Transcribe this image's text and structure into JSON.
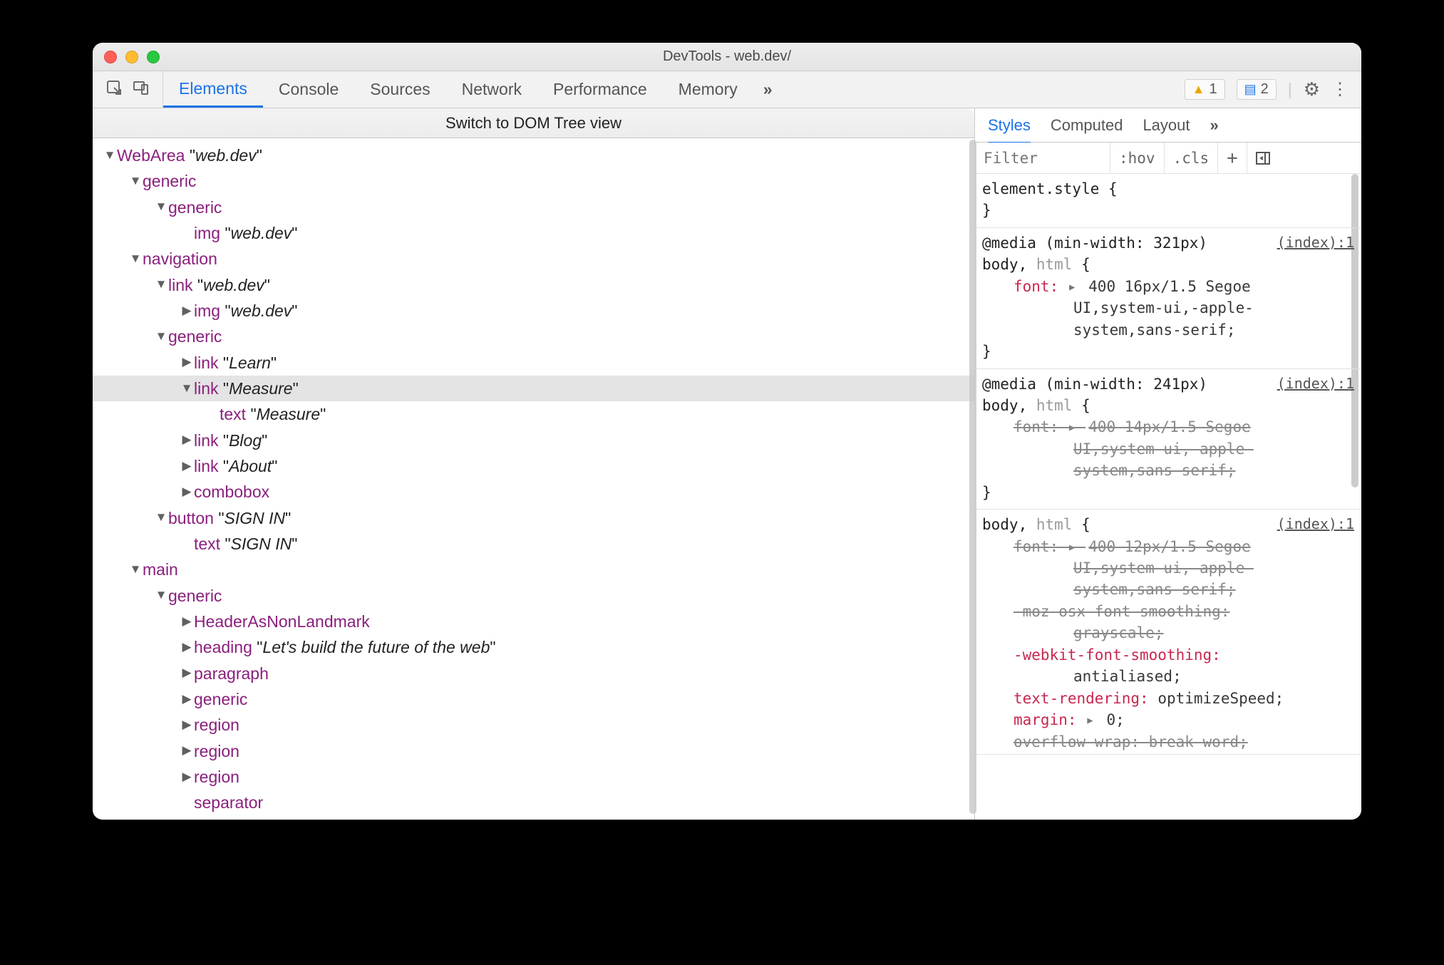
{
  "window": {
    "title": "DevTools - web.dev/"
  },
  "toolbar": {
    "tabs": [
      "Elements",
      "Console",
      "Sources",
      "Network",
      "Performance",
      "Memory"
    ],
    "more": "»",
    "warnings_count": "1",
    "issues_count": "2"
  },
  "switch_bar": "Switch to DOM Tree view",
  "tree": [
    {
      "ind": 0,
      "arrow": "down",
      "role": "WebArea",
      "name": "web.dev"
    },
    {
      "ind": 1,
      "arrow": "down",
      "role": "generic"
    },
    {
      "ind": 2,
      "arrow": "down",
      "role": "generic"
    },
    {
      "ind": 3,
      "arrow": "none",
      "role": "img",
      "name": "web.dev"
    },
    {
      "ind": 1,
      "arrow": "down",
      "role": "navigation"
    },
    {
      "ind": 2,
      "arrow": "down",
      "role": "link",
      "name": "web.dev"
    },
    {
      "ind": 3,
      "arrow": "right",
      "role": "img",
      "name": "web.dev"
    },
    {
      "ind": 2,
      "arrow": "down",
      "role": "generic"
    },
    {
      "ind": 3,
      "arrow": "right",
      "role": "link",
      "name": "Learn"
    },
    {
      "ind": 3,
      "arrow": "down",
      "role": "link",
      "name": "Measure",
      "selected": true
    },
    {
      "ind": 4,
      "arrow": "none",
      "role": "text",
      "name": "Measure"
    },
    {
      "ind": 3,
      "arrow": "right",
      "role": "link",
      "name": "Blog"
    },
    {
      "ind": 3,
      "arrow": "right",
      "role": "link",
      "name": "About"
    },
    {
      "ind": 3,
      "arrow": "right",
      "role": "combobox"
    },
    {
      "ind": 2,
      "arrow": "down",
      "role": "button",
      "name": "SIGN IN"
    },
    {
      "ind": 3,
      "arrow": "none",
      "role": "text",
      "name": "SIGN IN"
    },
    {
      "ind": 1,
      "arrow": "down",
      "role": "main"
    },
    {
      "ind": 2,
      "arrow": "down",
      "role": "generic"
    },
    {
      "ind": 3,
      "arrow": "right",
      "role": "HeaderAsNonLandmark"
    },
    {
      "ind": 3,
      "arrow": "right",
      "role": "heading",
      "name": "Let's build the future of the web"
    },
    {
      "ind": 3,
      "arrow": "right",
      "role": "paragraph"
    },
    {
      "ind": 3,
      "arrow": "right",
      "role": "generic"
    },
    {
      "ind": 3,
      "arrow": "right",
      "role": "region"
    },
    {
      "ind": 3,
      "arrow": "right",
      "role": "region"
    },
    {
      "ind": 3,
      "arrow": "right",
      "role": "region"
    },
    {
      "ind": 3,
      "arrow": "none",
      "role": "separator"
    }
  ],
  "styles": {
    "tabs": [
      "Styles",
      "Computed",
      "Layout"
    ],
    "more": "»",
    "filter_placeholder": "Filter",
    "hov": ":hov",
    "cls": ".cls",
    "element_style_open": "element.style {",
    "brace_close": "}",
    "rules": [
      {
        "media": "@media (min-width: 321px)",
        "selector_main": "body, ",
        "selector_dim": "html",
        "link": "(index):1",
        "decl_prop": "font:",
        "decl_val_l1": "400 16px/1.5 Segoe",
        "decl_val_l2": "UI,system-ui,-apple-",
        "decl_val_l3": "system,sans-serif;",
        "strike": false
      },
      {
        "media": "@media (min-width: 241px)",
        "selector_main": "body, ",
        "selector_dim": "html",
        "link": "(index):1",
        "decl_prop": "font:",
        "decl_val_l1": "400 14px/1.5 Segoe",
        "decl_val_l2": "UI,system-ui,-apple-",
        "decl_val_l3": "system,sans-serif;",
        "strike": true
      }
    ],
    "rule3": {
      "selector_main": "body, ",
      "selector_dim": "html",
      "link": "(index):1",
      "font_l1": "400 12px/1.5 Segoe",
      "font_l2": "UI,system-ui,-apple-",
      "font_l3": "system,sans-serif;",
      "moz_l1": "-moz-osx-font-smoothing:",
      "moz_l2": "grayscale;",
      "wk_prop": "-webkit-font-smoothing:",
      "wk_val": "antialiased;",
      "tr_prop": "text-rendering:",
      "tr_val": "optimizeSpeed;",
      "mg_prop": "margin:",
      "mg_val": "0;",
      "ow_prop": "overflow-wrap:",
      "ow_val": "break-word;"
    }
  }
}
